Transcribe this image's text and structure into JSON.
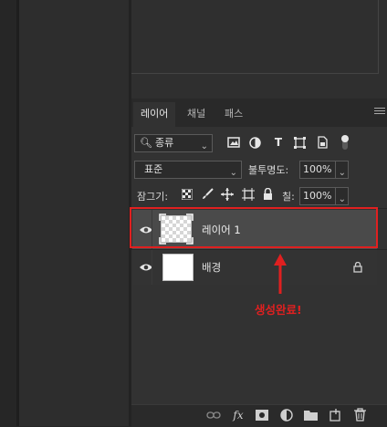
{
  "tabs": [
    {
      "label": "레이어",
      "active": true
    },
    {
      "label": "채널",
      "active": false
    },
    {
      "label": "패스",
      "active": false
    }
  ],
  "filter": {
    "label": "종류"
  },
  "blend": {
    "mode": "표준",
    "opacity_label": "불투명도:",
    "opacity_value": "100%"
  },
  "lock": {
    "label": "잠그기:",
    "fill_label": "칠:",
    "fill_value": "100%"
  },
  "layers": [
    {
      "name": "레이어 1",
      "selected": true,
      "transparent": true
    },
    {
      "name": "배경",
      "selected": false,
      "locked": true
    }
  ],
  "annotation": {
    "text": "생성완료!",
    "color": "#e02020"
  },
  "colors": {
    "accent_red": "#e02020",
    "selected_row": "#4a4a4a"
  }
}
